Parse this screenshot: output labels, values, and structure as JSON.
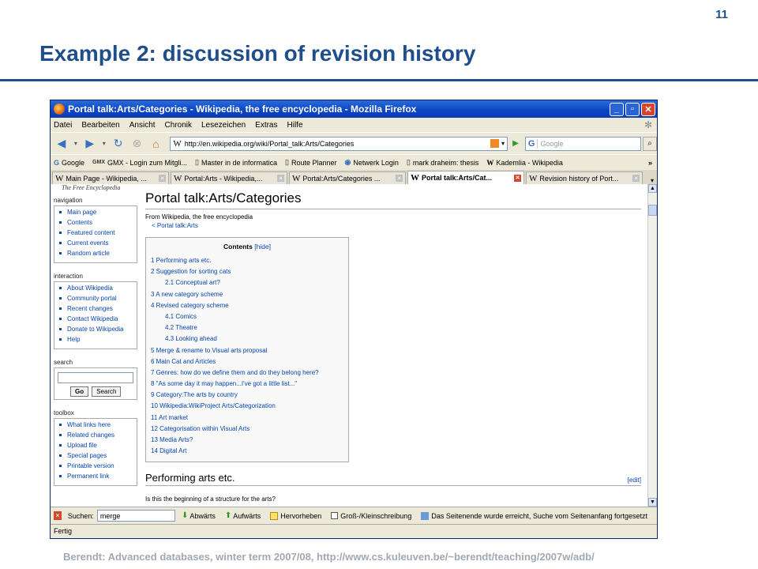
{
  "slide": {
    "number": "11",
    "title": "Example 2: discussion of revision history",
    "footer": "Berendt: Advanced databases, winter term 2007/08, http://www.cs.kuleuven.be/~berendt/teaching/2007w/adb/"
  },
  "browser": {
    "title": "Portal talk:Arts/Categories - Wikipedia, the free encyclopedia - Mozilla Firefox",
    "menu": [
      "Datei",
      "Bearbeiten",
      "Ansicht",
      "Chronik",
      "Lesezeichen",
      "Extras",
      "Hilfe"
    ],
    "url": "http://en.wikipedia.org/wiki/Portal_talk:Arts/Categories",
    "search_placeholder": "Google",
    "bookmarks": [
      "Google",
      "GMX - Login zum Mitgli...",
      "Master in de informatica",
      "Route Planner",
      "Netwerk Login",
      "mark draheim: thesis",
      "Kademlia - Wikipedia"
    ],
    "bookmarks_more": "»",
    "tabs": [
      "Main Page - Wikipedia, ...",
      "Portal:Arts - Wikipedia,...",
      "Portal:Arts/Categories ...",
      "Portal talk:Arts/Cat...",
      "Revision history of Port..."
    ],
    "active_tab": 3,
    "find": {
      "label": "Suchen:",
      "value": "merge",
      "down": "Abwärts",
      "up": "Aufwärts",
      "highlight": "Hervorheben",
      "case": "Groß-/Kleinschreibung",
      "message": "Das Seitenende wurde erreicht, Suche vom Seitenanfang fortgesetzt"
    },
    "status": "Fertig"
  },
  "wiki": {
    "logo_tail": "The Free Encyclopedia",
    "navigation_title": "navigation",
    "navigation": [
      "Main page",
      "Contents",
      "Featured content",
      "Current events",
      "Random article"
    ],
    "interaction_title": "interaction",
    "interaction": [
      "About Wikipedia",
      "Community portal",
      "Recent changes",
      "Contact Wikipedia",
      "Donate to Wikipedia",
      "Help"
    ],
    "search_title": "search",
    "go_label": "Go",
    "search_label": "Search",
    "toolbox_title": "toolbox",
    "toolbox": [
      "What links here",
      "Related changes",
      "Upload file",
      "Special pages",
      "Printable version",
      "Permanent link"
    ],
    "page_title": "Portal talk:Arts/Categories",
    "from": "From Wikipedia, the free encyclopedia",
    "back_link": "< Portal talk:Arts",
    "toc_title": "Contents",
    "toc_hide": "[hide]",
    "toc": [
      {
        "text": "1 Performing arts etc.",
        "sub": false
      },
      {
        "text": "2 Suggestion for sorting cats",
        "sub": false
      },
      {
        "text": "2.1 Conceptual art?",
        "sub": true
      },
      {
        "text": "3 A new category scheme",
        "sub": false
      },
      {
        "text": "4 Revised category scheme",
        "sub": false
      },
      {
        "text": "4.1 Comics",
        "sub": true
      },
      {
        "text": "4.2 Theatre",
        "sub": true
      },
      {
        "text": "4.3 Looking ahead",
        "sub": true
      },
      {
        "text": "5 Merge & rename to Visual arts proposal",
        "sub": false
      },
      {
        "text": "6 Main Cat and Articles",
        "sub": false
      },
      {
        "text": "7 Genres: how do we define them and do they belong here?",
        "sub": false
      },
      {
        "text": "8 \"As some day it may happen...I've got a little list...\"",
        "sub": false
      },
      {
        "text": "9 Category:The arts by country",
        "sub": false
      },
      {
        "text": "10 Wikipedia:WikiProject Arts/Categorization",
        "sub": false
      },
      {
        "text": "11 Art market",
        "sub": false
      },
      {
        "text": "12 Categorisation within Visual Arts",
        "sub": false
      },
      {
        "text": "13 Media Arts?",
        "sub": false
      },
      {
        "text": "14 Digital Art",
        "sub": false
      }
    ],
    "section_title": "Performing arts etc.",
    "edit_label": "[edit]",
    "section_text": "Is this the beginning of a structure for the arts?"
  }
}
